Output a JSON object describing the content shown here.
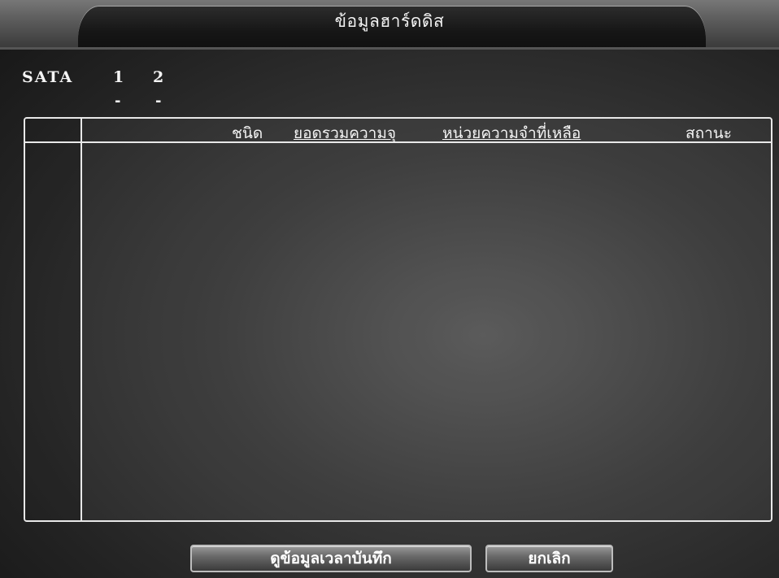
{
  "window": {
    "title": "ข้อมูลฮาร์ดดิส"
  },
  "sata": {
    "label": "SATA",
    "disks": [
      {
        "number": "1",
        "status": "-"
      },
      {
        "number": "2",
        "status": "-"
      }
    ]
  },
  "table": {
    "columns": [
      "ชนิด",
      "ยอดรวมความจุ",
      "หน่วยความจำที่เหลือ",
      "สถานะ"
    ],
    "rows": []
  },
  "buttons": {
    "view_record_time": "ดูข้อมูลเวลาบันทึก",
    "cancel": "ยกเลิก"
  }
}
